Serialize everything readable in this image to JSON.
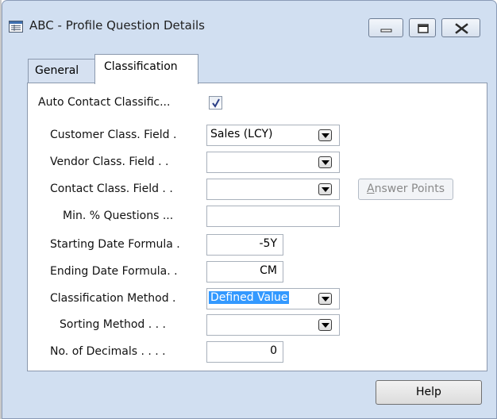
{
  "window": {
    "title": "ABC - Profile Question Details"
  },
  "tabs": [
    {
      "label": "General",
      "active": false
    },
    {
      "label": "Classification",
      "active": true
    }
  ],
  "form": {
    "auto_contact": {
      "label": "Auto Contact Classific...",
      "checked": true
    },
    "customer_class": {
      "label": "Customer Class. Field .",
      "value": "Sales (LCY)"
    },
    "vendor_class": {
      "label": "Vendor Class. Field  . .",
      "value": ""
    },
    "contact_class": {
      "label": "Contact Class. Field . .",
      "value": ""
    },
    "min_questions": {
      "label": "Min. % Questions ...",
      "value": ""
    },
    "starting_date": {
      "label": "Starting Date Formula .",
      "value": "-5Y"
    },
    "ending_date": {
      "label": "Ending Date Formula. .",
      "value": "CM"
    },
    "classification_method": {
      "label": "Classification Method  .",
      "value": "Defined Value"
    },
    "sorting_method": {
      "label": "Sorting Method  . . .",
      "value": ""
    },
    "no_of_decimals": {
      "label": "No. of Decimals . . . .",
      "value": "0"
    }
  },
  "buttons": {
    "answer_points_accel": "A",
    "answer_points_rest": "nswer Points",
    "help": "Help"
  },
  "colors": {
    "window_frame": "#d1dff1",
    "selection": "#3399ff",
    "disabled_text": "#8a8a8a"
  }
}
